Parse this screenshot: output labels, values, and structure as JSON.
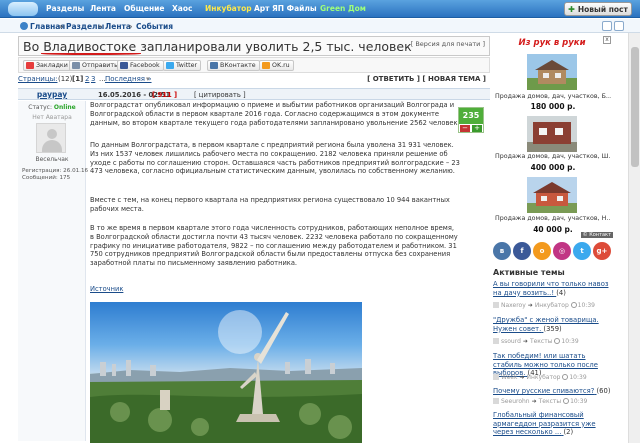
{
  "nav": {
    "items": [
      "Разделы",
      "Лента",
      "Общение",
      "Хаос",
      "Инкубатор",
      "Арт",
      "ЯП Файлы",
      "Green Дом"
    ],
    "new_post": "Новый пост"
  },
  "breadcrumbs": [
    "Главная",
    "Разделы",
    "Лента",
    "События"
  ],
  "topic": {
    "title": "Во Владивостоке запланировали уволить 2,5 тыс. человек",
    "print_link": "[ Версия для печати ]"
  },
  "share": [
    "Закладки",
    "Отправить",
    "Facebook",
    "Twitter",
    "ВКонтакте",
    "OK.ru"
  ],
  "pager": {
    "pages_label": "Страницы:",
    "count": "(12)",
    "current": "[1]",
    "pages": [
      "2",
      "3"
    ],
    "dots": "...",
    "last": "Последняя »",
    "reply": "[ ОТВЕТИТЬ ]",
    "new_topic": "[ НОВАЯ ТЕМА ]"
  },
  "post": {
    "author": "paypay",
    "date": "16.05.2016 - 02:51",
    "number": "911",
    "quote": "[ цитировать ]",
    "status_label": "Статус:",
    "status_value": "Online",
    "no_avatar": "Нет Аватара",
    "rank": "Весельчак",
    "registered": "Регистрация: 26.01.16",
    "messages": "Сообщений: 175",
    "score": "235",
    "minus": "−",
    "plus": "+",
    "paragraphs": [
      "Волгоградстат опубликовал информацию о приеме и выбытии работников организаций Волгограда и Волгоградской области в первом квартале 2016 года. Согласно содержащимся в этом документе данным, во втором квартале текущего года работодателями запланировано увольнение 2562 человек.",
      "По данным Волгоградстата, в первом квартале с предприятий региона была уволена 31 931 человек. Из них 1537 человек лишились рабочего места по сокращению. 2182 человека приняли решение об уходе с работы по соглашению сторон. Оставшаяся часть работников предприятий волгоградские – 23 473 человека, согласно официальным статистическим данным, уволилась по собственному желанию.",
      "Вместе с тем, на конец первого квартала на предприятиях региона существовало 10 944 вакантных рабочих места.",
      "В то же время в первом квартале этого года численность сотрудников, работающих неполное время, в Волгоградской области достигла почти 43 тысяч человек. 2232 человека работало по сокращенному графику по инициативе работодателя, 9822 – по соглашению между работодателем и работником. 31 750 сотрудников предприятий Волгоградской области были предоставлены отпуска без сохранения заработной платы по письменному заявлению работника."
    ],
    "source_link": "Источник"
  },
  "ad": {
    "brand": "Из рук в руки",
    "close": "x",
    "watermark": "© Контакт",
    "items": [
      {
        "caption": "Продажа домов, дач, участков, Б...",
        "price": "180 000 р."
      },
      {
        "caption": "Продажа домов, дач, участков, Ш...",
        "price": "400 000 р."
      },
      {
        "caption": "Продажа домов, дач, участков, Н...",
        "price": "40 000 р."
      }
    ]
  },
  "socials": [
    "vk-icon",
    "facebook-icon",
    "ok-icon",
    "instagram-icon",
    "twitter-icon",
    "google-plus-icon"
  ],
  "topics": {
    "title": "Активные темы",
    "items": [
      {
        "title": "А вы говорили что только навоз на дачу возить..!",
        "count": "(4)",
        "user": "Naxeroy",
        "section": "Инкубатор",
        "time": "10:39"
      },
      {
        "title": "\"Дружба\" с женой товарища. Нужен совет.",
        "count": "(359)",
        "user": "ssourd",
        "section": "Тексты",
        "time": "10:39"
      },
      {
        "title": "Так победим! или шатать стабиль можно только после выборов.",
        "count": "(41)",
        "user": "Week",
        "section": "Инкубатор",
        "time": "10:39"
      },
      {
        "title": "Почему русские спиваются?",
        "count": "(60)",
        "user": "Seeurohn",
        "section": "Тексты",
        "time": "10:39"
      },
      {
        "title": "Глобальный финансовый армагеддон разразится уже через несколько ...",
        "count": "(2)",
        "user": "",
        "section": "",
        "time": ""
      }
    ]
  },
  "colors": {
    "nav_bg": "#2b72bf",
    "link": "#1a4c8a",
    "score_green": "#4fae3a",
    "title_underline": "#d21a1a"
  }
}
